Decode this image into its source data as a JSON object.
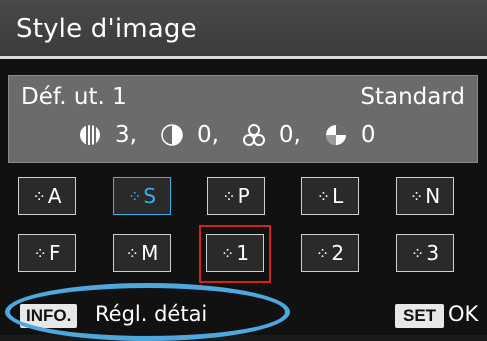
{
  "header": {
    "title": "Style d'image"
  },
  "info": {
    "current_style": "Déf. ut. 1",
    "base_style": "Standard",
    "params": [
      {
        "icon": "sharpness-icon",
        "value": "3,"
      },
      {
        "icon": "contrast-icon",
        "value": "0,"
      },
      {
        "icon": "saturation-icon",
        "value": "0,"
      },
      {
        "icon": "color-tone-icon",
        "value": "0"
      }
    ]
  },
  "styles": [
    {
      "icon": "style-icon",
      "label": "A"
    },
    {
      "icon": "style-icon",
      "label": "S",
      "active": true
    },
    {
      "icon": "style-icon",
      "label": "P"
    },
    {
      "icon": "style-icon",
      "label": "L"
    },
    {
      "icon": "style-icon",
      "label": "N"
    },
    {
      "icon": "style-icon",
      "label": "F"
    },
    {
      "icon": "style-icon",
      "label": "M"
    },
    {
      "icon": "style-icon",
      "label": "1",
      "selected": true
    },
    {
      "icon": "style-icon",
      "label": "2"
    },
    {
      "icon": "style-icon",
      "label": "3"
    }
  ],
  "footer": {
    "info_key": "INFO.",
    "detail_label": "Régl. détai",
    "set_key": "SET",
    "ok_label": "OK"
  },
  "colors": {
    "accent": "#3ab0e8",
    "selection": "#d42020",
    "highlight": "#4ea8e0"
  }
}
